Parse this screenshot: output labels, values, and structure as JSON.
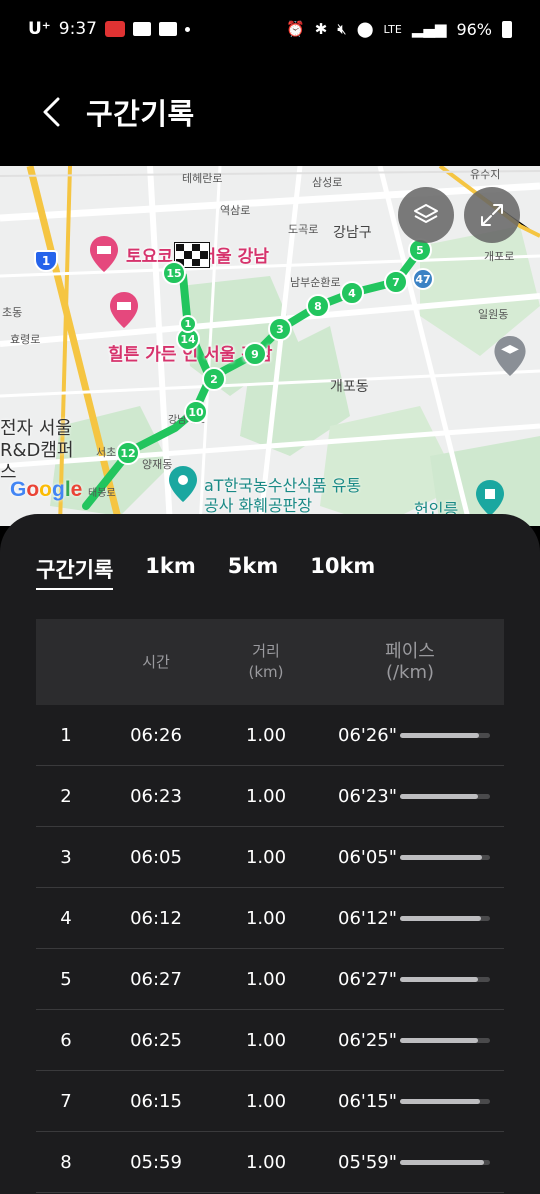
{
  "status": {
    "carrier": "U⁺",
    "time": "9:37",
    "network": "LTE",
    "battery": "96%"
  },
  "header": {
    "title": "구간기록"
  },
  "map": {
    "labels": [
      "유수지",
      "테헤란로",
      "역삼로",
      "도곡로",
      "삼성로",
      "강남구",
      "남부순환로",
      "개포로",
      "일원동",
      "개포동",
      "양재동",
      "초동",
      "효령로",
      "서초",
      "강남대로",
      "태봉로"
    ],
    "places": {
      "hotel1": "토요코 인 서울 강남",
      "hotel2": "힐튼 가든 인 서울 강남",
      "campus": "전자 서울 R&D캠퍼스",
      "at_center": "aT한국농수산식품 유통공사 화훼공판장",
      "heonilleung": "헌인릉"
    },
    "road_badges": [
      "1",
      "47"
    ],
    "segment_markers": [
      "1",
      "2",
      "3",
      "4",
      "5",
      "7",
      "8",
      "9",
      "10",
      "12",
      "14",
      "15"
    ],
    "google": "Google"
  },
  "tabs": [
    {
      "label": "구간기록",
      "active": true
    },
    {
      "label": "1km",
      "active": false
    },
    {
      "label": "5km",
      "active": false
    },
    {
      "label": "10km",
      "active": false
    }
  ],
  "table": {
    "headers": {
      "time": "시간",
      "distance": "거리",
      "distance_unit": "(km)",
      "pace": "페이스",
      "pace_unit": "(/km)"
    },
    "rows": [
      {
        "idx": "1",
        "time": "06:26",
        "dist": "1.00",
        "pace": "06'26\"",
        "bar": 0.88
      },
      {
        "idx": "2",
        "time": "06:23",
        "dist": "1.00",
        "pace": "06'23\"",
        "bar": 0.87
      },
      {
        "idx": "3",
        "time": "06:05",
        "dist": "1.00",
        "pace": "06'05\"",
        "bar": 0.91
      },
      {
        "idx": "4",
        "time": "06:12",
        "dist": "1.00",
        "pace": "06'12\"",
        "bar": 0.9
      },
      {
        "idx": "5",
        "time": "06:27",
        "dist": "1.00",
        "pace": "06'27\"",
        "bar": 0.87
      },
      {
        "idx": "6",
        "time": "06:25",
        "dist": "1.00",
        "pace": "06'25\"",
        "bar": 0.87
      },
      {
        "idx": "7",
        "time": "06:15",
        "dist": "1.00",
        "pace": "06'15\"",
        "bar": 0.89
      },
      {
        "idx": "8",
        "time": "05:59",
        "dist": "1.00",
        "pace": "05'59\"",
        "bar": 0.93
      }
    ]
  },
  "colors": {
    "route": "#22c55e",
    "pace_bar": "#bdbdc0",
    "panel": "#1c1c1e"
  }
}
